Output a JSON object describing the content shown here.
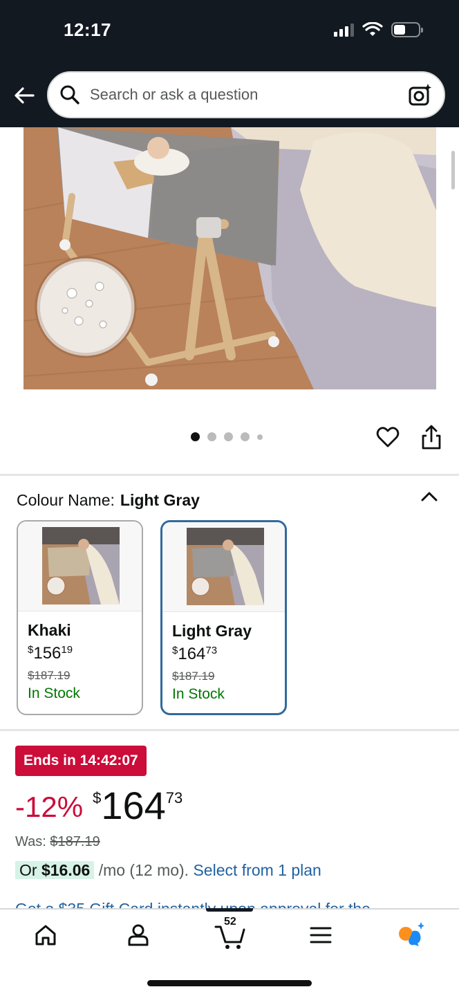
{
  "status_bar": {
    "time": "12:17"
  },
  "header": {
    "search_placeholder": "Search or ask a question"
  },
  "product": {
    "image_alt": "Bedside crib with baby next to bed",
    "gallery_count": 5,
    "gallery_active_index": 0
  },
  "colour": {
    "label": "Colour Name:",
    "selected": "Light Gray",
    "options": [
      {
        "name": "Khaki",
        "price_currency": "$",
        "price_whole": "156",
        "price_fraction": "19",
        "was": "$187.19",
        "stock": "In Stock"
      },
      {
        "name": "Light Gray",
        "price_currency": "$",
        "price_whole": "164",
        "price_fraction": "73",
        "was": "$187.19",
        "stock": "In Stock"
      }
    ]
  },
  "deal": {
    "badge": "Ends in 14:42:07",
    "discount": "-12%",
    "currency": "$",
    "price_whole": "164",
    "price_fraction": "73",
    "was_label": "Was:",
    "was_price": "$187.19",
    "plan_prefix": "Or",
    "plan_amount": "$16.06",
    "plan_suffix": "/mo (12 mo).",
    "plan_link": "Select from 1 plan",
    "gift_card_partial": "Get a $35 Gift Card instantly upon approval for the"
  },
  "bottom_nav": {
    "cart_count": "52"
  },
  "colors": {
    "header_bg": "#131921",
    "deal_red": "#cc0c39",
    "link_blue": "#2162a1",
    "stock_green": "#007600",
    "selected_border": "#2f6a9c"
  }
}
